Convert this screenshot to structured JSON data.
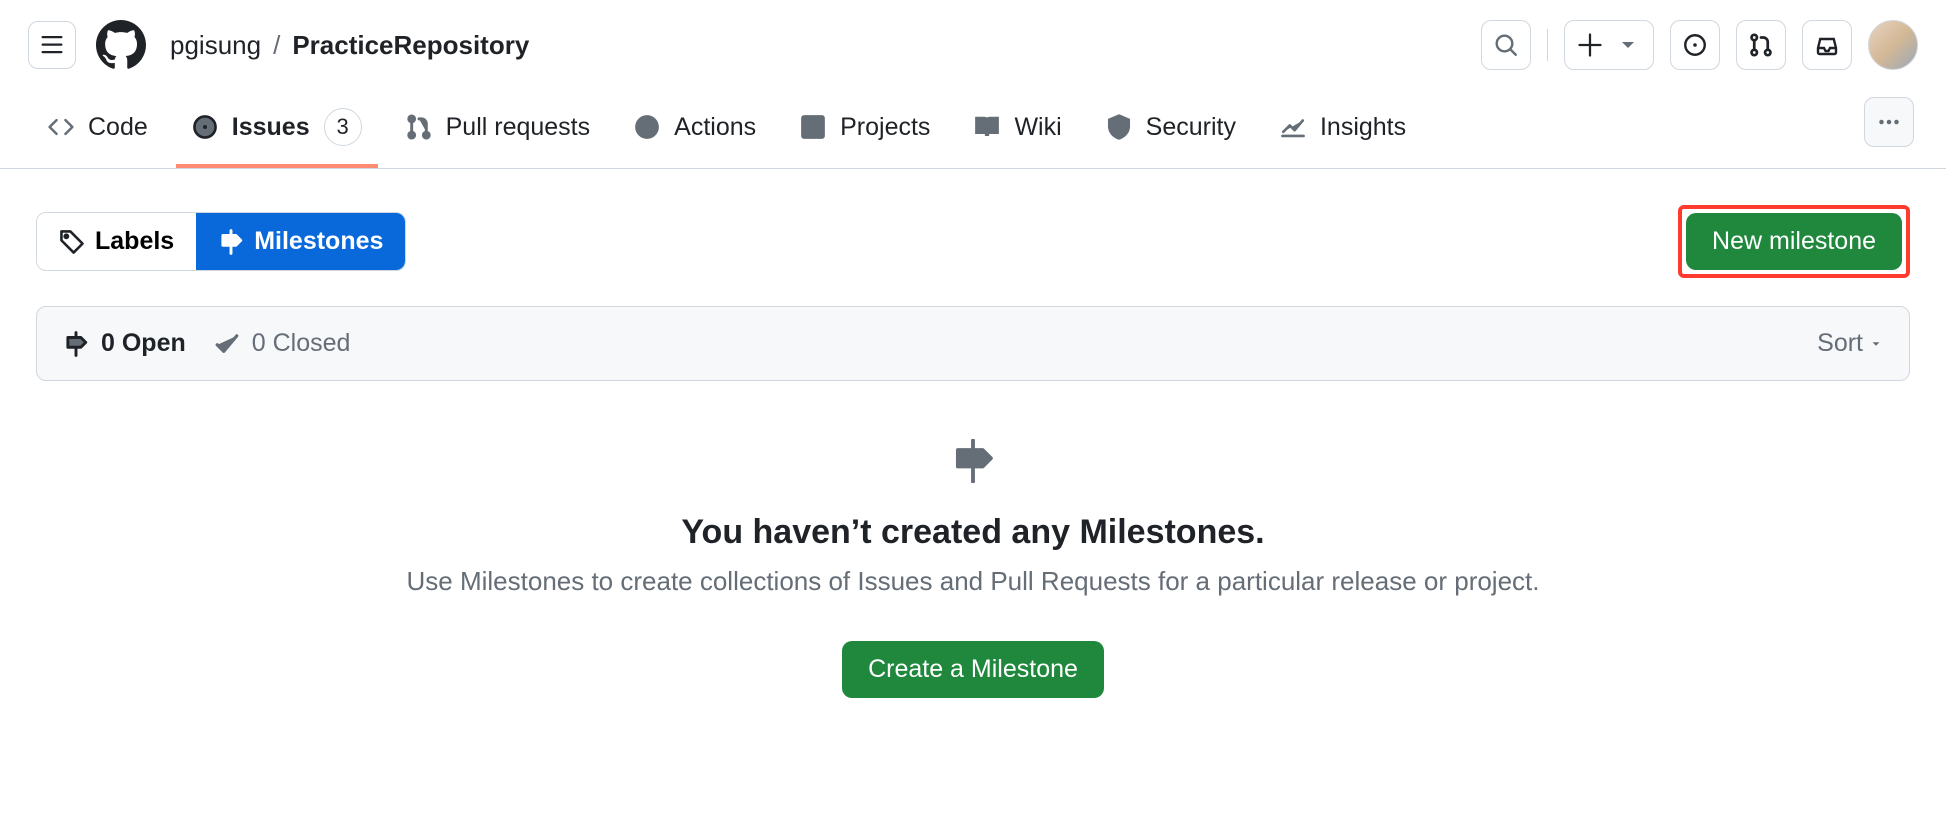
{
  "header": {
    "owner": "pgisung",
    "separator": "/",
    "repo": "PracticeRepository"
  },
  "nav": {
    "code": "Code",
    "issues": "Issues",
    "issues_count": "3",
    "pulls": "Pull requests",
    "actions": "Actions",
    "projects": "Projects",
    "wiki": "Wiki",
    "security": "Security",
    "insights": "Insights"
  },
  "subnav": {
    "labels": "Labels",
    "milestones": "Milestones",
    "new_milestone": "New milestone"
  },
  "table": {
    "open": "0 Open",
    "closed": "0 Closed",
    "sort": "Sort"
  },
  "blankslate": {
    "title": "You haven’t created any Milestones.",
    "description": "Use Milestones to create collections of Issues and Pull Requests for a particular release or project.",
    "cta": "Create a Milestone"
  }
}
